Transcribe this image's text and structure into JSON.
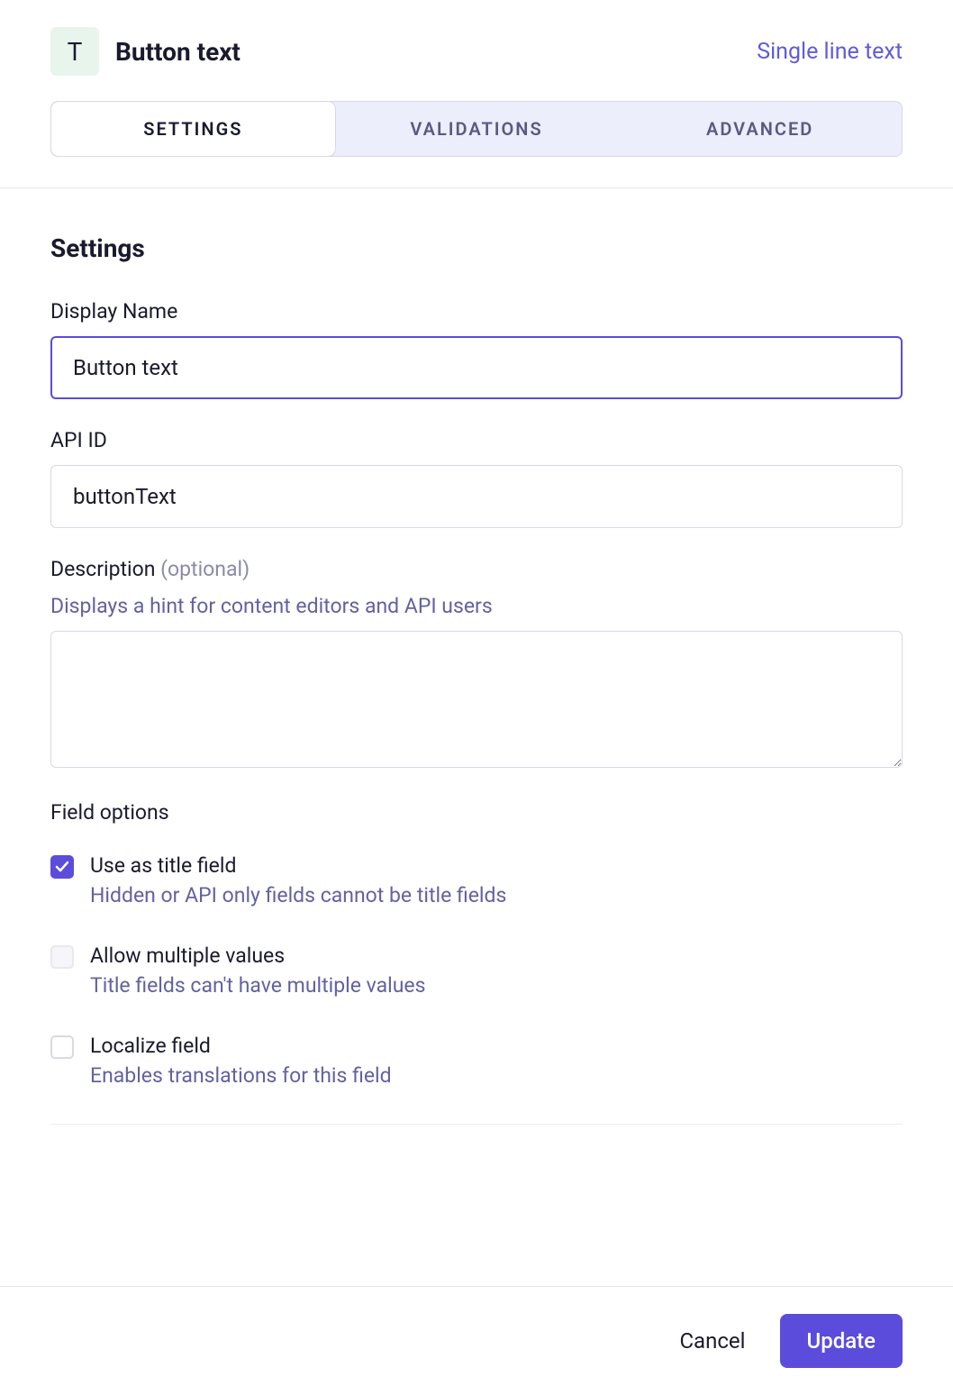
{
  "header": {
    "icon_letter": "T",
    "title": "Button text",
    "type_label": "Single line text"
  },
  "tabs": {
    "settings": "SETTINGS",
    "validations": "VALIDATIONS",
    "advanced": "ADVANCED"
  },
  "section": {
    "title": "Settings"
  },
  "display_name": {
    "label": "Display Name",
    "value": "Button text"
  },
  "api_id": {
    "label": "API ID",
    "value": "buttonText"
  },
  "description": {
    "label": "Description",
    "optional": "(optional)",
    "hint": "Displays a hint for content editors and API users",
    "value": ""
  },
  "field_options": {
    "title": "Field options",
    "use_as_title": {
      "label": "Use as title field",
      "hint": "Hidden or API only fields cannot be title fields",
      "checked": true
    },
    "allow_multiple": {
      "label": "Allow multiple values",
      "hint": "Title fields can't have multiple values",
      "disabled": true
    },
    "localize": {
      "label": "Localize field",
      "hint": "Enables translations for this field",
      "checked": false
    }
  },
  "footer": {
    "cancel": "Cancel",
    "update": "Update"
  }
}
